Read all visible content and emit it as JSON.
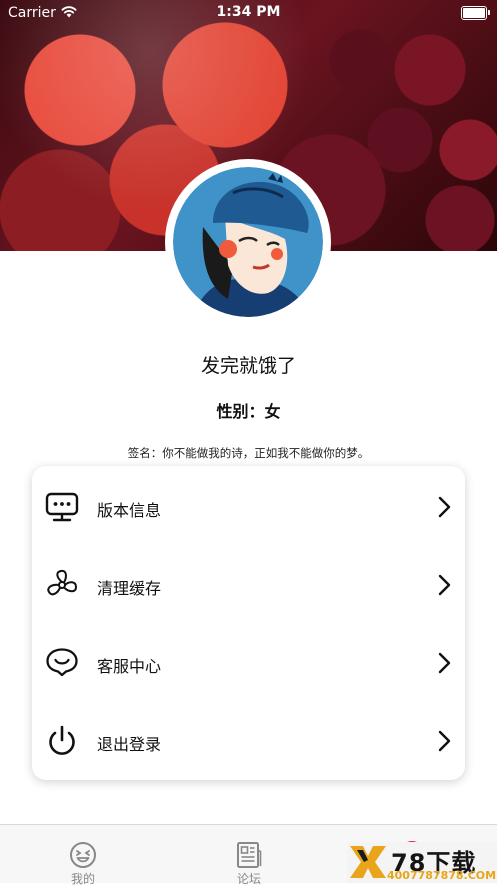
{
  "status_bar": {
    "carrier": "Carrier",
    "time": "1:34 PM"
  },
  "profile": {
    "nickname": "发完就饿了",
    "gender": "性别：女",
    "signature": "签名：你不能做我的诗，正如我不能做你的梦。"
  },
  "menu": [
    {
      "label": "版本信息",
      "icon": "version-info-icon"
    },
    {
      "label": "清理缓存",
      "icon": "clear-cache-icon"
    },
    {
      "label": "客服中心",
      "icon": "customer-service-icon"
    },
    {
      "label": "退出登录",
      "icon": "logout-icon"
    }
  ],
  "tabs": [
    {
      "label": "我的",
      "icon": "smile-face-icon"
    },
    {
      "label": "论坛",
      "icon": "forum-document-icon"
    }
  ],
  "watermark": {
    "title": "78下载",
    "url": "4007787878.COM",
    "accent": "#e8a51a"
  },
  "colors": {
    "text": "#111111",
    "tab_inactive": "#888888",
    "tab_active_partial": "#d9203a"
  }
}
